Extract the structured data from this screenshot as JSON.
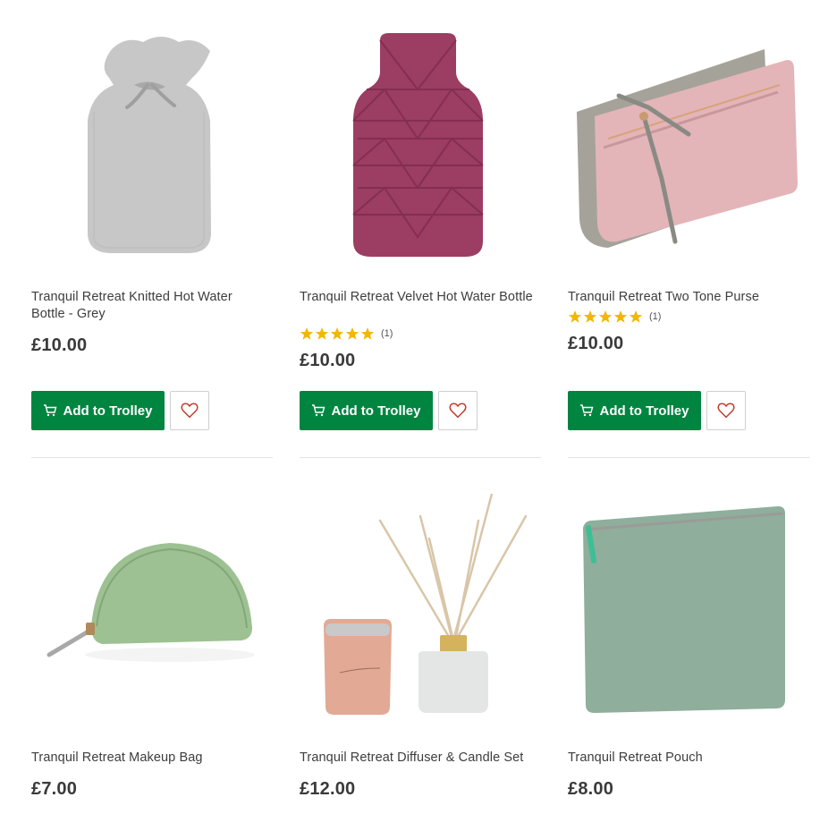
{
  "products": [
    {
      "title": "Tranquil Retreat Knitted Hot Water Bottle - Grey",
      "price": "£10.00",
      "rating": null,
      "image": "grey-knitted-hot-water-bottle",
      "add_label": "Add to Trolley"
    },
    {
      "title": "Tranquil Retreat Velvet Hot Water Bottle",
      "price": "£10.00",
      "rating": {
        "stars": 5,
        "count": "(1)"
      },
      "image": "velvet-hot-water-bottle",
      "add_label": "Add to Trolley"
    },
    {
      "title": "Tranquil Retreat Two Tone Purse",
      "price": "£10.00",
      "rating": {
        "stars": 5,
        "count": "(1)"
      },
      "image": "two-tone-purse",
      "add_label": "Add to Trolley"
    },
    {
      "title": "Tranquil Retreat Makeup Bag",
      "price": "£7.00",
      "rating": null,
      "image": "makeup-bag"
    },
    {
      "title": "Tranquil Retreat Diffuser & Candle Set",
      "price": "£12.00",
      "rating": null,
      "image": "diffuser-candle-set"
    },
    {
      "title": "Tranquil Retreat Pouch",
      "price": "£8.00",
      "rating": null,
      "image": "pouch"
    }
  ],
  "colors": {
    "button_green": "#008540",
    "star_gold": "#f2b705",
    "heart_red": "#c0392b",
    "divider": "#e2e2e2"
  }
}
